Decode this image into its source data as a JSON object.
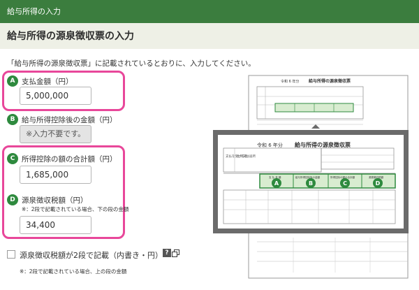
{
  "topbar": {
    "title": "給与所得の入力"
  },
  "page": {
    "title": "給与所得の源泉徴収票の入力"
  },
  "instruction": "「給与所得の源泉徴収票」に記載されているとおりに、入力してください。",
  "fields": [
    {
      "badge": "A",
      "label": "支払金額（円）",
      "value": "5,000,000"
    },
    {
      "badge": "B",
      "label": "給与所得控除後の金額（円）",
      "value": "※入力不要です。"
    },
    {
      "badge": "C",
      "label": "所得控除の額の合計額（円）",
      "value": "1,685,000"
    },
    {
      "badge": "D",
      "label": "源泉徴収税額（円）",
      "note": "※：2段で記載されている場合、下の段の金額",
      "value": "34,400"
    }
  ],
  "checkbox": {
    "label": "源泉徴収税額が2段で記載（内書き・円）",
    "help": "?"
  },
  "footnote": "※：2段で記載されている場合、上の段の金額",
  "illustration": {
    "year": "令和 6 年分",
    "title_small": "給与所得の源泉徴収票",
    "title_zoom": "給与所得の源泉徴収票",
    "markers": [
      "A",
      "B",
      "C",
      "D"
    ],
    "headers": [
      "支 払 金 額",
      "給与所得控除後の金額",
      "所得控除の額の合計額",
      "源泉徴収税額"
    ],
    "labels": [
      "支払を受ける者",
      "住所又は居所"
    ],
    "colors": {
      "highlight": "#2e8a3e",
      "tint": "#d8ecd0",
      "frame": "#6b6b6b",
      "sheet": "#ffffff"
    }
  },
  "colors": {
    "topbar": "#3b7d3e",
    "header_bg": "#eef0e6",
    "pink": "#e8479a",
    "badge": "#2e8a3e"
  }
}
